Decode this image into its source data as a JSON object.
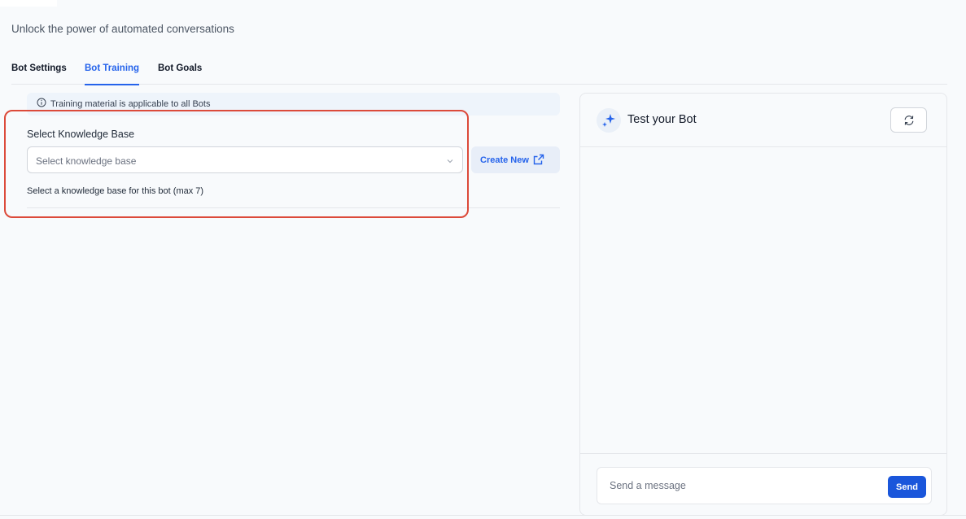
{
  "header": {
    "subtitle": "Unlock the power of automated conversations"
  },
  "tabs": [
    {
      "label": "Bot Settings",
      "active": false
    },
    {
      "label": "Bot Training",
      "active": true
    },
    {
      "label": "Bot Goals",
      "active": false
    }
  ],
  "training": {
    "info_text": "Training material is applicable to all Bots",
    "knowledge_base_title": "Select Knowledge Base",
    "select_placeholder": "Select knowledge base",
    "create_new_label": "Create New",
    "help_text": "Select a knowledge base for this bot (max 7)"
  },
  "chat": {
    "title": "Test your Bot",
    "input_placeholder": "Send a message",
    "send_label": "Send"
  },
  "colors": {
    "accent": "#2563eb",
    "highlight_border": "#dc4a3a",
    "send_button": "#1a56db"
  },
  "icons": {
    "info": "info-circle-icon",
    "chevron": "chevron-down-icon",
    "external_link": "external-link-icon",
    "sparkle": "sparkle-icon",
    "refresh": "refresh-icon"
  }
}
